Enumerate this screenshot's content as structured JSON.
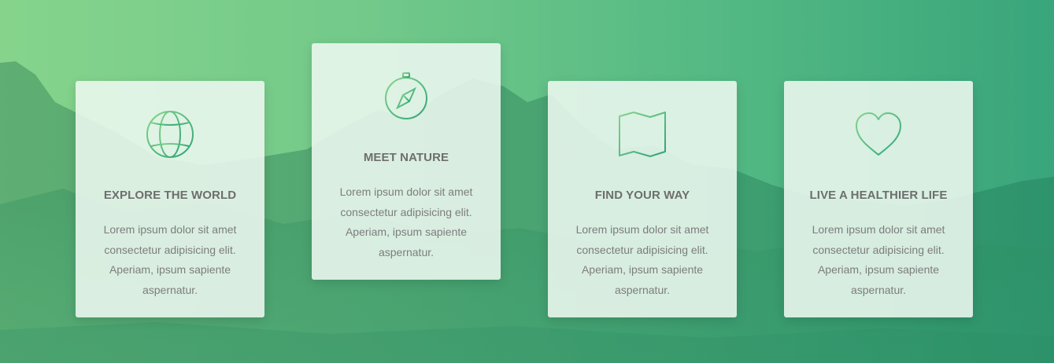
{
  "colors": {
    "background_start": "#86d48c",
    "background_end": "#39a57b",
    "icon_gradient_start": "#86d48c",
    "icon_gradient_end": "#2ea576",
    "card_background": "#edf8f0",
    "title_color": "#6e6e6e",
    "text_color": "#7d7d7d"
  },
  "features": [
    {
      "icon": "globe-icon",
      "title": "EXPLORE THE WORLD",
      "text": "Lorem ipsum dolor sit amet consectetur adipisicing elit. Aperiam, ipsum sapiente aspernatur."
    },
    {
      "icon": "compass-icon",
      "title": "MEET NATURE",
      "text": "Lorem ipsum dolor sit amet consectetur adipisicing elit. Aperiam, ipsum sapiente aspernatur."
    },
    {
      "icon": "map-icon",
      "title": "FIND YOUR WAY",
      "text": "Lorem ipsum dolor sit amet consectetur adipisicing elit. Aperiam, ipsum sapiente aspernatur."
    },
    {
      "icon": "heart-icon",
      "title": "LIVE A HEALTHIER LIFE",
      "text": "Lorem ipsum dolor sit amet consectetur adipisicing elit. Aperiam, ipsum sapiente aspernatur."
    }
  ]
}
